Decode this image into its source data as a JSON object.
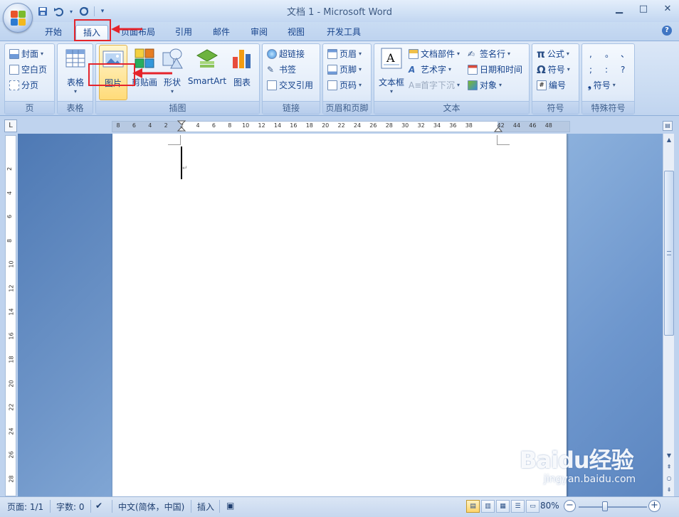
{
  "title_bar": {
    "title": "文档 1 - Microsoft Word",
    "minimize": "▁",
    "maximize": "□",
    "close": "✕"
  },
  "tabs": [
    "开始",
    "插入",
    "页面布局",
    "引用",
    "邮件",
    "审阅",
    "视图",
    "开发工具"
  ],
  "active_tab": "插入",
  "ribbon": {
    "pages": {
      "label": "页",
      "cover": "封面",
      "blank_page": "空白页",
      "page_break": "分页"
    },
    "tables": {
      "label": "表格",
      "table": "表格"
    },
    "illustrations": {
      "label": "插图",
      "picture": "图片",
      "clipart": "剪贴画",
      "shapes": "形状",
      "smartart": "SmartArt",
      "chart": "图表"
    },
    "links": {
      "label": "链接",
      "hyperlink": "超链接",
      "bookmark": "书签",
      "cross_reference": "交叉引用"
    },
    "header_footer": {
      "label": "页眉和页脚",
      "header": "页眉",
      "footer": "页脚",
      "page_number": "页码"
    },
    "text": {
      "label": "文本",
      "textbox": "文本框",
      "quick_parts": "文档部件",
      "wordart": "艺术字",
      "dropcap": "首字下沉",
      "signature_line": "签名行",
      "date_time": "日期和时间",
      "object": "对象"
    },
    "symbols": {
      "label": "符号",
      "equation": "公式",
      "symbol": "符号",
      "number": "编号"
    },
    "special_symbols": {
      "label": "特殊符号",
      "chars": [
        ",",
        "。",
        "、",
        ";",
        ":",
        "?"
      ],
      "symbol": "符号"
    }
  },
  "ruler": {
    "corner": "L",
    "h_numbers": [
      "8",
      "6",
      "4",
      "2",
      "2",
      "4",
      "6",
      "8",
      "10",
      "12",
      "14",
      "16",
      "18",
      "20",
      "22",
      "24",
      "26",
      "28",
      "30",
      "32",
      "34",
      "36",
      "38",
      "42",
      "44",
      "46",
      "48"
    ],
    "v_numbers": [
      "2",
      "4",
      "6",
      "8",
      "10",
      "12",
      "14",
      "16",
      "18",
      "20",
      "22",
      "24",
      "26",
      "28"
    ]
  },
  "statusbar": {
    "page": "页面: 1/1",
    "words": "字数: 0",
    "language": "中文(简体，中国)",
    "mode": "插入",
    "zoom": "80%",
    "zoom_minus": "−",
    "zoom_plus": "+"
  },
  "watermark": {
    "main": "Baidu经验",
    "sub": "jingyan.baidu.com"
  }
}
